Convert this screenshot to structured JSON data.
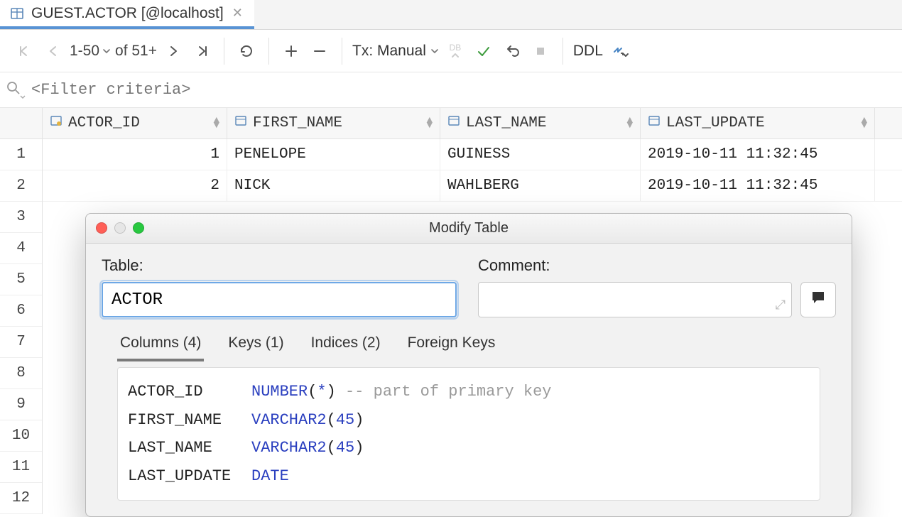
{
  "tab": {
    "title": "GUEST.ACTOR [@localhost]"
  },
  "toolbar": {
    "page_range": "1-50",
    "of_label": "of 51+",
    "tx_label": "Tx: Manual",
    "db_label": "DB",
    "ddl_label": "DDL"
  },
  "filter": {
    "placeholder": "<Filter criteria>"
  },
  "columns": [
    {
      "name": "ACTOR_ID"
    },
    {
      "name": "FIRST_NAME"
    },
    {
      "name": "LAST_NAME"
    },
    {
      "name": "LAST_UPDATE"
    }
  ],
  "rows": [
    {
      "n": "1",
      "actor_id": "1",
      "first_name": "PENELOPE",
      "last_name": "GUINESS",
      "last_update": "2019-10-11 11:32:45"
    },
    {
      "n": "2",
      "actor_id": "2",
      "first_name": "NICK",
      "last_name": "WAHLBERG",
      "last_update": "2019-10-11 11:32:45"
    }
  ],
  "row_numbers_rest": [
    "3",
    "4",
    "5",
    "6",
    "7",
    "8",
    "9",
    "10",
    "11",
    "12"
  ],
  "modal": {
    "title": "Modify Table",
    "table_label": "Table:",
    "table_value": "ACTOR",
    "comment_label": "Comment:",
    "tabs": {
      "columns": "Columns (4)",
      "keys": "Keys (1)",
      "indices": "Indices (2)",
      "fkeys": "Foreign Keys"
    },
    "schema": [
      {
        "col": "ACTOR_ID",
        "type": "NUMBER",
        "arg": "*",
        "comment": "-- part of primary key"
      },
      {
        "col": "FIRST_NAME",
        "type": "VARCHAR2",
        "arg": "45",
        "comment": ""
      },
      {
        "col": "LAST_NAME",
        "type": "VARCHAR2",
        "arg": "45",
        "comment": ""
      },
      {
        "col": "LAST_UPDATE",
        "type": "DATE",
        "arg": "",
        "comment": ""
      }
    ]
  }
}
